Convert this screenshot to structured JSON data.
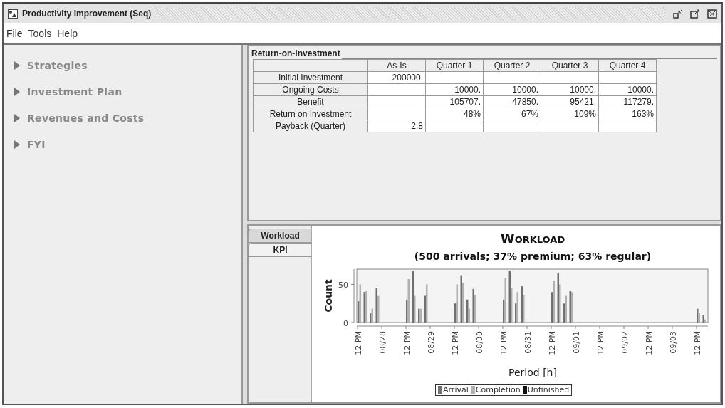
{
  "window": {
    "title": "Productivity Improvement (Seq)"
  },
  "menu": [
    "File",
    "Tools",
    "Help"
  ],
  "sidebar": {
    "items": [
      {
        "label": "Strategies",
        "expanded": false
      },
      {
        "label": "Investment Plan",
        "expanded": false
      },
      {
        "label": "Revenues and Costs",
        "expanded": false
      },
      {
        "label": "FYI",
        "expanded": false
      }
    ]
  },
  "roi": {
    "title": "Return-on-Investment",
    "columns": [
      "",
      "As-Is",
      "Quarter 1",
      "Quarter 2",
      "Quarter 3",
      "Quarter 4"
    ],
    "rows": [
      [
        "Initial Investment",
        "200000.",
        "",
        "",
        "",
        ""
      ],
      [
        "Ongoing Costs",
        "",
        "10000.",
        "10000.",
        "10000.",
        "10000."
      ],
      [
        "Benefit",
        "",
        "105707.",
        "47850.",
        "95421.",
        "117279."
      ],
      [
        "Return on Investment",
        "",
        "48%",
        "67%",
        "109%",
        "163%"
      ],
      [
        "Payback (Quarter)",
        "2.8",
        "",
        "",
        "",
        ""
      ]
    ]
  },
  "tabs": [
    {
      "label": "Workload",
      "selected": true
    },
    {
      "label": "KPI",
      "selected": false
    }
  ],
  "chart": {
    "chart_data": {
      "type": "bar",
      "title": "Workload",
      "subtitle": "(500 arrivals; 37% premium; 63% regular)",
      "xlabel": "Period [h]",
      "ylabel": "Count",
      "categories": [
        "12 PM",
        null,
        null,
        null,
        "08/28",
        null,
        null,
        null,
        "12 PM",
        null,
        null,
        null,
        "08/29",
        null,
        null,
        null,
        "12 PM",
        null,
        null,
        null,
        "08/30",
        null,
        null,
        null,
        "12 PM",
        null,
        null,
        null,
        "08/31",
        null,
        null,
        null,
        "12 PM",
        null,
        null,
        null,
        "09/01",
        null,
        null,
        null,
        "12 PM",
        null,
        null,
        null,
        "09/02",
        null,
        null,
        null,
        "12 PM",
        null,
        null,
        null,
        "09/03",
        null,
        null,
        null,
        "12 PM",
        null
      ],
      "series": [
        {
          "name": "Arrival",
          "color": "#707070",
          "values": [
            28,
            40,
            12,
            45,
            0,
            0,
            0,
            0,
            30,
            68,
            18,
            35,
            0,
            0,
            0,
            0,
            25,
            62,
            30,
            44,
            0,
            0,
            0,
            0,
            30,
            68,
            25,
            48,
            0,
            0,
            0,
            0,
            40,
            65,
            25,
            42,
            0,
            0,
            0,
            0,
            0,
            0,
            0,
            0,
            0,
            0,
            0,
            0,
            0,
            0,
            0,
            0,
            0,
            0,
            0,
            0,
            18,
            10
          ]
        },
        {
          "name": "Completion",
          "color": "#b0b0b0",
          "values": [
            50,
            42,
            18,
            35,
            0,
            0,
            0,
            0,
            57,
            35,
            18,
            50,
            0,
            0,
            0,
            0,
            50,
            52,
            18,
            36,
            0,
            0,
            0,
            0,
            58,
            45,
            40,
            36,
            0,
            0,
            0,
            0,
            55,
            50,
            35,
            40,
            0,
            0,
            0,
            0,
            0,
            0,
            0,
            0,
            0,
            0,
            0,
            0,
            0,
            0,
            0,
            0,
            0,
            0,
            0,
            0,
            12,
            4
          ]
        },
        {
          "name": "Unfinished",
          "color": "#101010",
          "values": [
            0,
            0,
            0,
            0,
            0,
            0,
            0,
            0,
            0,
            0,
            0,
            0,
            0,
            0,
            0,
            0,
            0,
            0,
            0,
            0,
            0,
            0,
            0,
            0,
            0,
            0,
            0,
            0,
            0,
            0,
            0,
            0,
            0,
            0,
            0,
            0,
            0,
            0,
            0,
            0,
            0,
            0,
            0,
            0,
            0,
            0,
            0,
            0,
            0,
            0,
            0,
            0,
            0,
            0,
            0,
            0,
            0,
            0
          ]
        }
      ],
      "ylim": [
        0,
        70
      ],
      "yticks": [
        0,
        50
      ]
    }
  }
}
